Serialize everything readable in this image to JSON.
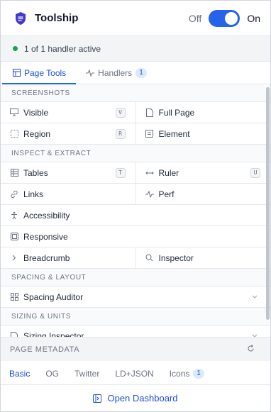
{
  "header": {
    "title": "Toolship",
    "toggle_off": "Off",
    "toggle_on": "On",
    "enabled": true
  },
  "status": {
    "text": "1 of 1 handler active",
    "color": "#16a34a"
  },
  "tabs": [
    {
      "label": "Page Tools",
      "active": true
    },
    {
      "label": "Handlers",
      "badge": "1",
      "active": false
    }
  ],
  "sections": {
    "screenshots": "SCREENSHOTS",
    "inspect": "INSPECT & EXTRACT",
    "spacing": "SPACING & LAYOUT",
    "sizing": "SIZING & UNITS"
  },
  "tools": {
    "visible": {
      "label": "Visible",
      "key": "V"
    },
    "full_page": {
      "label": "Full Page"
    },
    "region": {
      "label": "Region",
      "key": "R"
    },
    "element": {
      "label": "Element"
    },
    "tables": {
      "label": "Tables",
      "key": "T"
    },
    "ruler": {
      "label": "Ruler",
      "key": "U"
    },
    "links": {
      "label": "Links"
    },
    "perf": {
      "label": "Perf"
    },
    "accessibility": {
      "label": "Accessibility"
    },
    "responsive": {
      "label": "Responsive"
    },
    "breadcrumb": {
      "label": "Breadcrumb"
    },
    "inspector": {
      "label": "Inspector"
    },
    "spacing_auditor": {
      "label": "Spacing Auditor"
    },
    "sizing_inspector": {
      "label": "Sizing Inspector"
    }
  },
  "metadata": {
    "title": "PAGE METADATA",
    "tabs": [
      {
        "label": "Basic",
        "active": true
      },
      {
        "label": "OG"
      },
      {
        "label": "Twitter"
      },
      {
        "label": "LD+JSON"
      },
      {
        "label": "Icons",
        "badge": "1"
      }
    ]
  },
  "footer": {
    "label": "Open Dashboard"
  },
  "colors": {
    "accent": "#2563eb",
    "accent_text": "#1d4ed8"
  }
}
